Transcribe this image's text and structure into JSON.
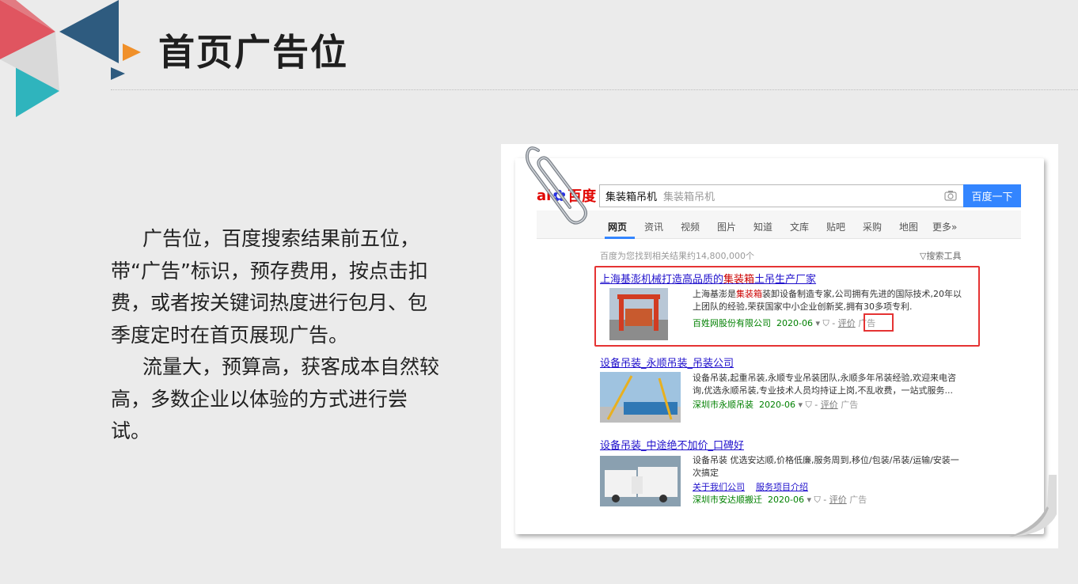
{
  "slide": {
    "title": "首页广告位",
    "paragraph1": "广告位，百度搜索结果前五位，带“广告”标识，预存费用，按点击扣费，或者按关键词热度进行包月、包季度定时在首页展现广告。",
    "paragraph2": "流量大，预算高，获客成本自然较高，多数企业以体验的方式进行尝试。"
  },
  "colors": {
    "accent_red": "#e05560",
    "accent_blue": "#2e5b7f",
    "accent_teal": "#2fb4bd",
    "accent_orange": "#f0902a",
    "baidu_blue": "#3385ff",
    "highlight_red": "#e53333"
  },
  "baidu": {
    "logo_left": "ai",
    "logo_right": "百度",
    "search_query": "集装箱吊机",
    "search_placeholder": "集装箱吊机",
    "search_button": "百度一下",
    "tabs": [
      "网页",
      "资讯",
      "视频",
      "图片",
      "知道",
      "文库",
      "贴吧",
      "采购",
      "地图",
      "更多»"
    ],
    "stats": "百度为您找到相关结果约14,800,000个",
    "tools": "搜索工具",
    "results": [
      {
        "title_pre": "上海基澎机械打造高品质的",
        "title_hl": "集装箱",
        "title_post": "土吊生产厂家",
        "desc_pre": "上海基澎是",
        "desc_hl": "集装箱",
        "desc_post": "装卸设备制造专家,公司拥有先进的国际技术,20年以上团队的经验,荣获国家中小企业创新奖,拥有30多项专利.",
        "source": "百姓网股份有限公司",
        "date": "2020-06",
        "review": "评价",
        "ad": "广告"
      },
      {
        "title": "设备吊装_永顺吊装_吊装公司",
        "desc": "设备吊装,起重吊装,永顺专业吊装团队,永顺多年吊装经验,欢迎来电咨询,优选永顺吊装,专业技术人员均持证上岗,不乱收费，一站式服务...",
        "source": "深圳市永顺吊装",
        "date": "2020-06",
        "review": "评价",
        "ad": "广告"
      },
      {
        "title": "设备吊装_中途绝不加价_口碑好",
        "desc": "设备吊装 优选安达顺,价格低廉,服务周到,移位/包装/吊装/运输/安装一次搞定",
        "link1": "关于我们公司",
        "link2": "服务项目介绍",
        "source": "深圳市安达顺搬迁",
        "date": "2020-06",
        "review": "评价",
        "ad": "广告"
      }
    ]
  }
}
